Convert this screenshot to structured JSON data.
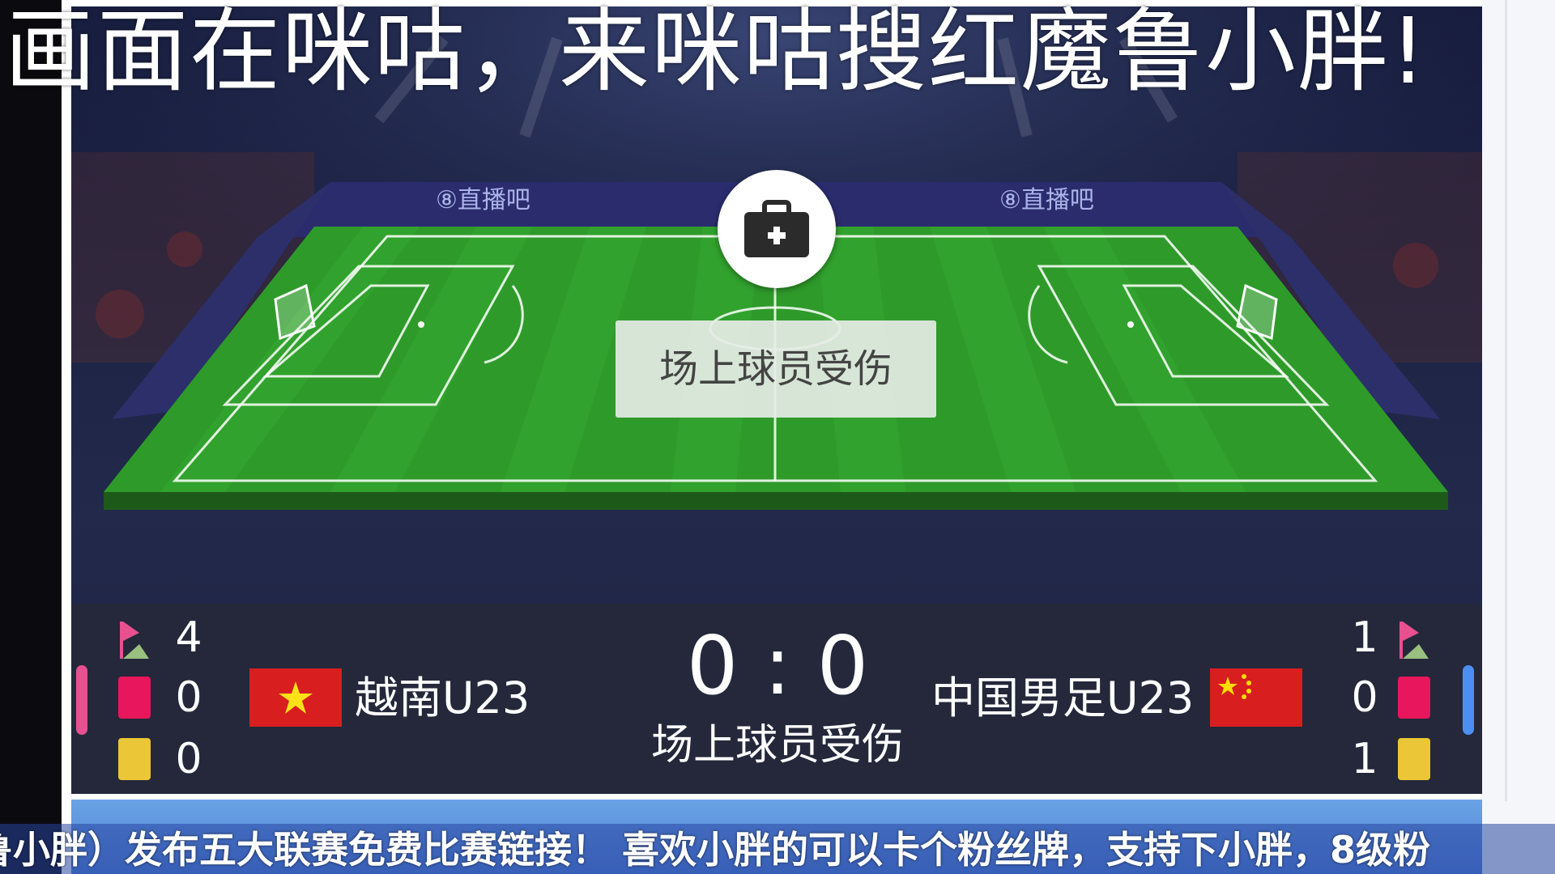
{
  "overlay": {
    "caption": "画面在咪咕，来咪咕搜红魔鲁小胖!"
  },
  "pitch": {
    "sponsor_text": "直播吧",
    "event_label": "场上球员受伤",
    "event_icon": "medical-kit-icon"
  },
  "match": {
    "score": "0 : 0",
    "status": "场上球员受伤",
    "home": {
      "name": "越南U23",
      "flag": "vietnam-flag",
      "corners": "4",
      "red_cards": "0",
      "yellow_cards": "0",
      "accent_color": "#e8508f"
    },
    "away": {
      "name": "中国男足U23",
      "flag": "china-flag",
      "corners": "1",
      "red_cards": "0",
      "yellow_cards": "1",
      "accent_color": "#4d8ff0"
    }
  },
  "ticker": {
    "text": "鲁小胖）发布五大联赛免费比赛链接！ 喜欢小胖的可以卡个粉丝牌，支持下小胖，8级粉"
  },
  "colors": {
    "pitch_green": "#2e9a2a",
    "red_card": "#e8165c",
    "yellow_card": "#ebc637"
  }
}
